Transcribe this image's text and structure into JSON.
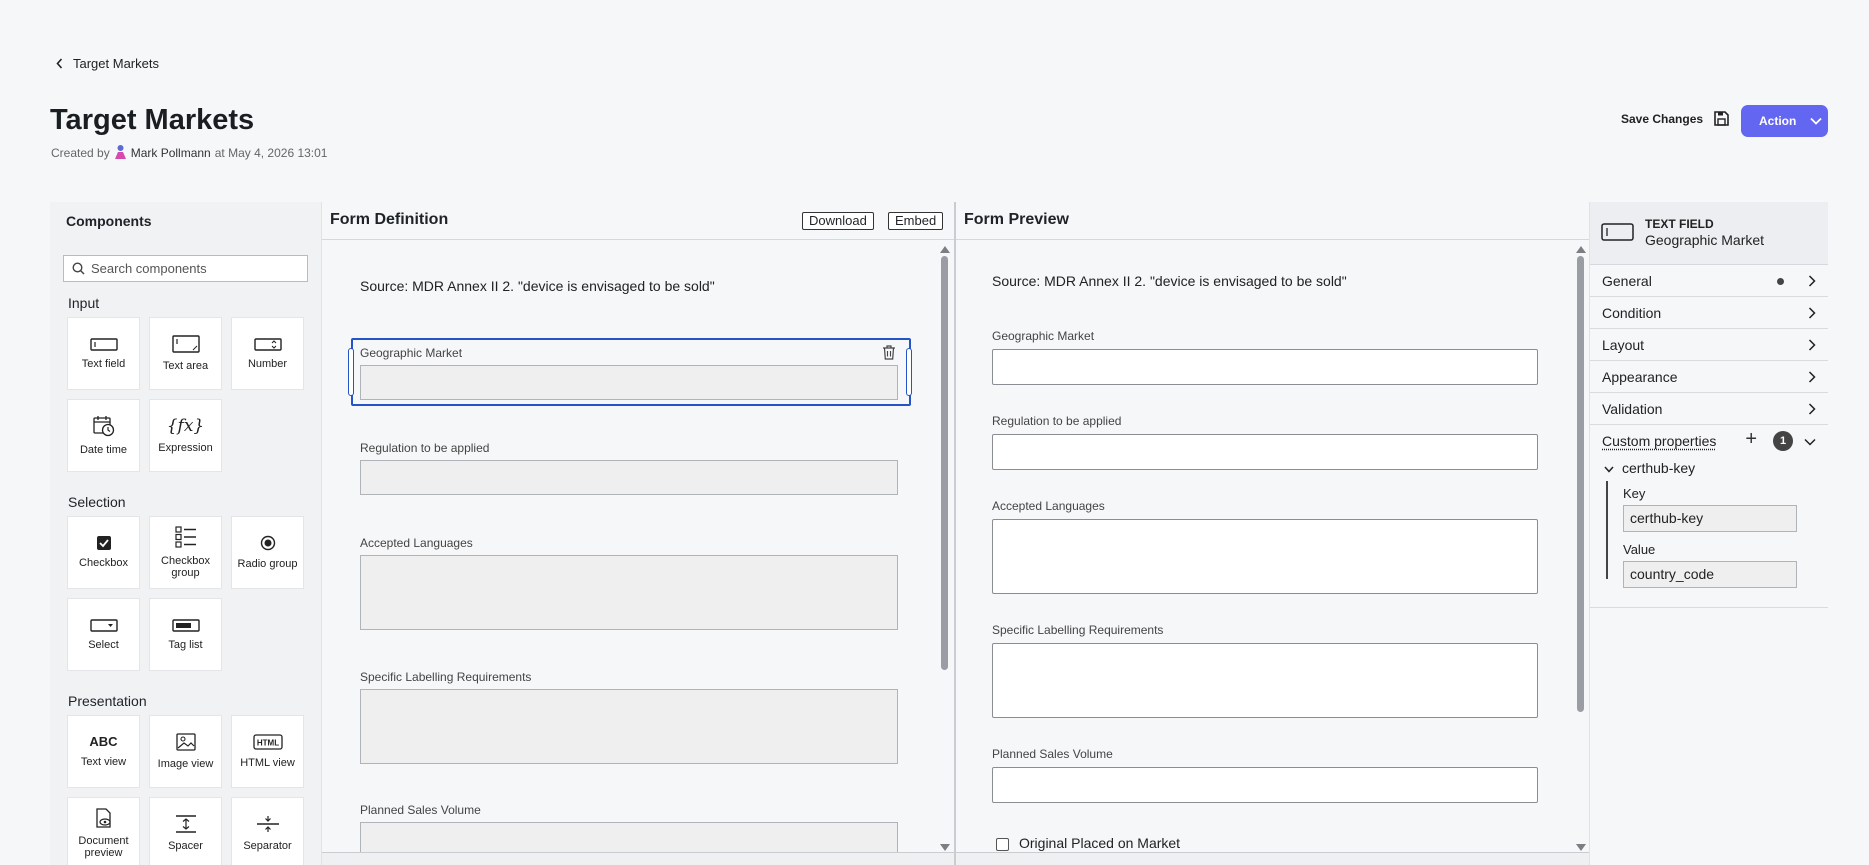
{
  "breadcrumb": {
    "label": "Target Markets"
  },
  "page": {
    "title": "Target Markets",
    "created_prefix": "Created by",
    "author": "Mark Pollmann",
    "created_suffix": "at May 4, 2026 13:01"
  },
  "toolbar": {
    "save_label": "Save Changes",
    "action_label": "Action"
  },
  "components": {
    "title": "Components",
    "search_placeholder": "Search components",
    "sections": [
      {
        "label": "Input",
        "items": [
          "Text field",
          "Text area",
          "Number",
          "Date time",
          "Expression"
        ]
      },
      {
        "label": "Selection",
        "items": [
          "Checkbox",
          "Checkbox group",
          "Radio group",
          "Select",
          "Tag list"
        ]
      },
      {
        "label": "Presentation",
        "items": [
          "Text view",
          "Image view",
          "HTML view",
          "Document preview",
          "Spacer",
          "Separator"
        ]
      }
    ]
  },
  "definition": {
    "title": "Form Definition",
    "download_label": "Download",
    "embed_label": "Embed",
    "source_text": "Source: MDR Annex II 2. \"device is envisaged to be sold\"",
    "fields": [
      "Geographic Market",
      "Regulation to be applied",
      "Accepted Languages",
      "Specific Labelling Requirements",
      "Planned Sales Volume"
    ]
  },
  "preview": {
    "title": "Form Preview",
    "source_text": "Source: MDR Annex II 2. \"device is envisaged to be sold\"",
    "fields": [
      "Geographic Market",
      "Regulation to be applied",
      "Accepted Languages",
      "Specific Labelling Requirements",
      "Planned Sales Volume"
    ],
    "checkbox_label": "Original Placed on Market"
  },
  "inspector": {
    "type_label": "TEXT FIELD",
    "field_name": "Geographic Market",
    "rows": [
      "General",
      "Condition",
      "Layout",
      "Appearance",
      "Validation"
    ],
    "custom_properties": {
      "label": "Custom properties",
      "count": "1",
      "item_name": "certhub-key",
      "key_label": "Key",
      "key_value": "certhub-key",
      "value_label": "Value",
      "value_value": "country_code"
    }
  },
  "colors": {
    "accent": "#6366f1",
    "selection": "#2454c7"
  }
}
